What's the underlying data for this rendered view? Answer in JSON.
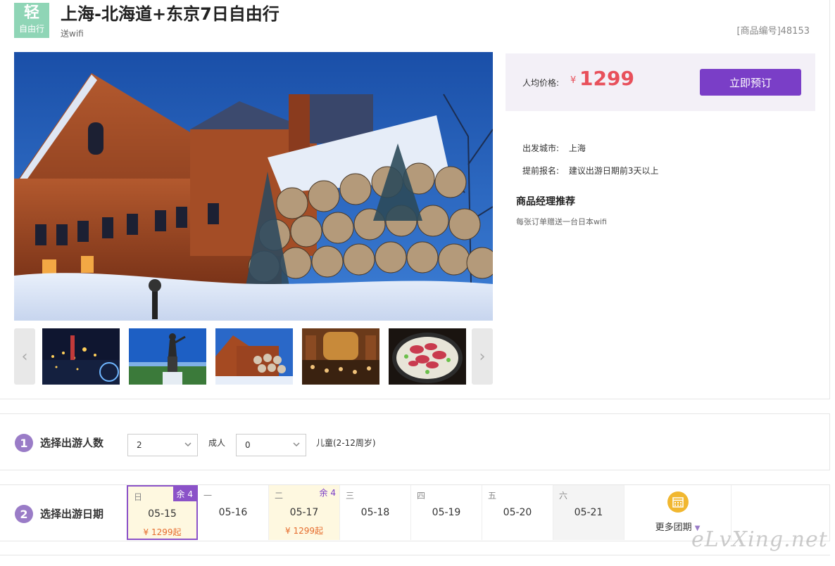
{
  "header": {
    "badge_main": "轻",
    "badge_sub": "自由行",
    "title": "上海-北海道+东京7日自由行",
    "subtitle": "送wifi",
    "product_code": "[商品编号]48153"
  },
  "gallery": {
    "prev_icon": "chevron-left-icon",
    "next_icon": "chevron-right-icon",
    "prev_glyph": "‹",
    "next_glyph": "›",
    "thumbs": [
      "harbor-night",
      "statue",
      "brick-brewery",
      "beer-hall",
      "grilled-lamb"
    ]
  },
  "price": {
    "label": "人均价格:",
    "currency": "¥",
    "amount": "1299",
    "book_label": "立即预订"
  },
  "info": {
    "departure_key": "出发城市:",
    "departure_val": "上海",
    "advance_key": "提前报名:",
    "advance_val": "建议出游日期前3天以上"
  },
  "manager": {
    "title": "商品经理推荐",
    "text": "每张订单赠送一台日本wifi"
  },
  "step1": {
    "num": "1",
    "label": "选择出游人数",
    "adult_value": "2",
    "adult_label": "成人",
    "child_value": "0",
    "child_label": "儿童(2-12周岁)"
  },
  "step2": {
    "num": "2",
    "label": "选择出游日期",
    "days": [
      {
        "weekday": "日",
        "date": "05-15",
        "price": "¥ 1299起",
        "remain": "余 4"
      },
      {
        "weekday": "一",
        "date": "05-16",
        "price": "",
        "remain": ""
      },
      {
        "weekday": "二",
        "date": "05-17",
        "price": "¥ 1299起",
        "remain": "余 4"
      },
      {
        "weekday": "三",
        "date": "05-18",
        "price": "",
        "remain": ""
      },
      {
        "weekday": "四",
        "date": "05-19",
        "price": "",
        "remain": ""
      },
      {
        "weekday": "五",
        "date": "05-20",
        "price": "",
        "remain": ""
      },
      {
        "weekday": "六",
        "date": "05-21",
        "price": "",
        "remain": ""
      }
    ],
    "more_label": "更多团期",
    "more_arrow": "▼"
  },
  "watermark": "eLvXing.net",
  "colors": {
    "accent": "#7a3ec7",
    "price_red": "#e8505b",
    "badge_green": "#8fd5b6",
    "step_purple": "#9a7cc7",
    "available_bg": "#fef8e0"
  }
}
